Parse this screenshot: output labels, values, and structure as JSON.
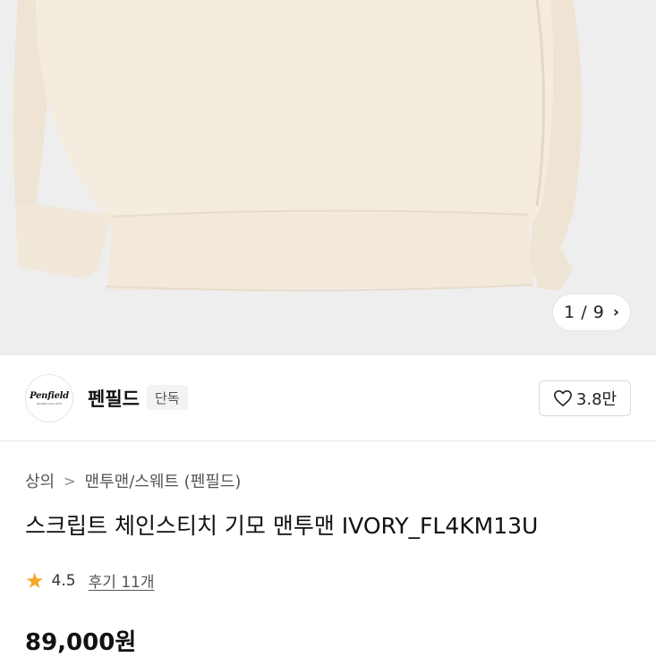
{
  "gallery": {
    "current": "1",
    "separator": "/",
    "total": "9",
    "next_icon": "chevron-right-icon",
    "background_color": "#eeeeee",
    "garment_color": "#f4ecdf"
  },
  "brand": {
    "logo_text": "Penfield",
    "logo_subtext": "Penfield USA 1975",
    "name": "펜필드",
    "tag": "단독",
    "like_icon": "heart-outline-icon",
    "like_count": "3.8만"
  },
  "breadcrumb": {
    "items": [
      "상의",
      "맨투맨/스웨트 (펜필드)"
    ],
    "separator": ">"
  },
  "product": {
    "title": "스크립트 체인스티치 기모 맨투맨 IVORY_FL4KM13U",
    "rating": "4.5",
    "rating_icon": "star-icon",
    "rating_color": "#f5a623",
    "reviews": "후기 11개",
    "price": "89,000원"
  }
}
